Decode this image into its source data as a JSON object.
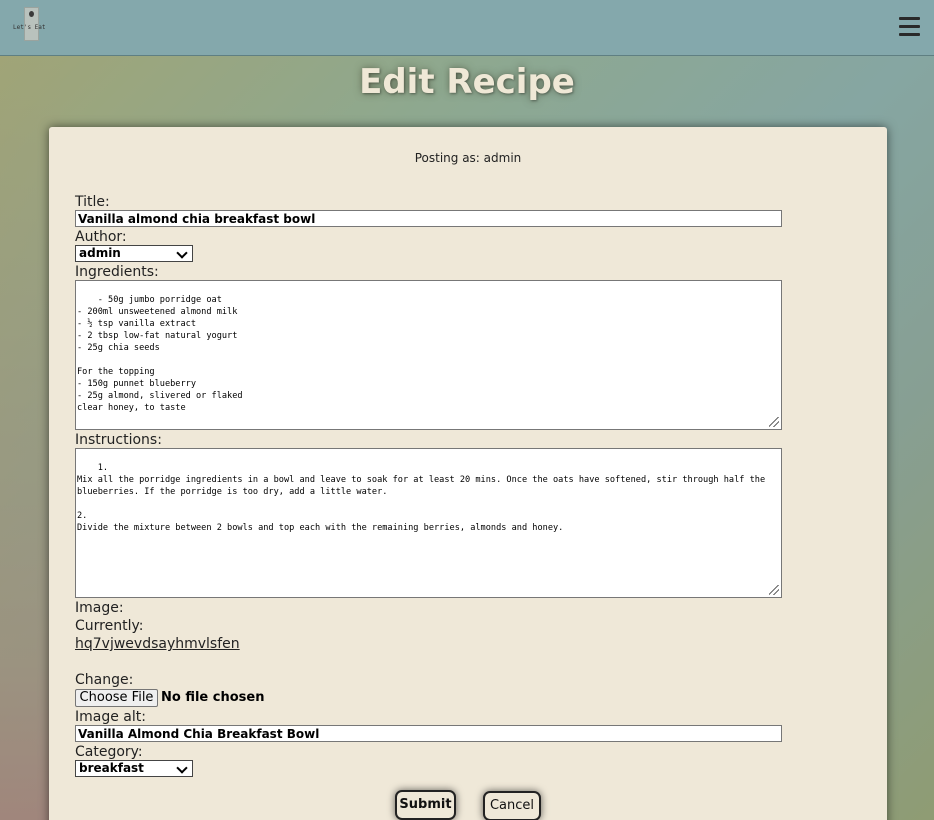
{
  "navbar": {
    "logo_text": "Let's Eat",
    "menu_icon": "hamburger-menu-icon"
  },
  "page": {
    "title": "Edit Recipe"
  },
  "form": {
    "posting_as": "Posting as: admin",
    "title_label": "Title:",
    "title_value": "Vanilla almond chia breakfast bowl",
    "author_label": "Author:",
    "author_selected": "admin",
    "ingredients_label": "Ingredients:",
    "ingredients_value": "- 50g jumbo porridge oat\n- 200ml unsweetened almond milk\n- ½ tsp vanilla extract\n- 2 tbsp low-fat natural yogurt\n- 25g chia seeds\n\nFor the topping\n- 150g punnet blueberry\n- 25g almond, slivered or flaked\nclear honey, to taste",
    "instructions_label": "Instructions:",
    "instructions_value": "1.\nMix all the porridge ingredients in a bowl and leave to soak for at least 20 mins. Once the oats have softened, stir through half the blueberries. If the porridge is too dry, add a little water.\n\n2.\nDivide the mixture between 2 bowls and top each with the remaining berries, almonds and honey.",
    "image_label": "Image:",
    "currently_label": "Currently:",
    "current_image_link": "hq7vjwevdsayhmvlsfen",
    "change_label": "Change:",
    "choose_file_label": "Choose File",
    "file_status": "No file chosen",
    "image_alt_label": "Image alt:",
    "image_alt_value": "Vanilla Almond Chia Breakfast Bowl",
    "category_label": "Category:",
    "category_selected": "breakfast",
    "submit_label": "Submit",
    "cancel_label": "Cancel"
  }
}
